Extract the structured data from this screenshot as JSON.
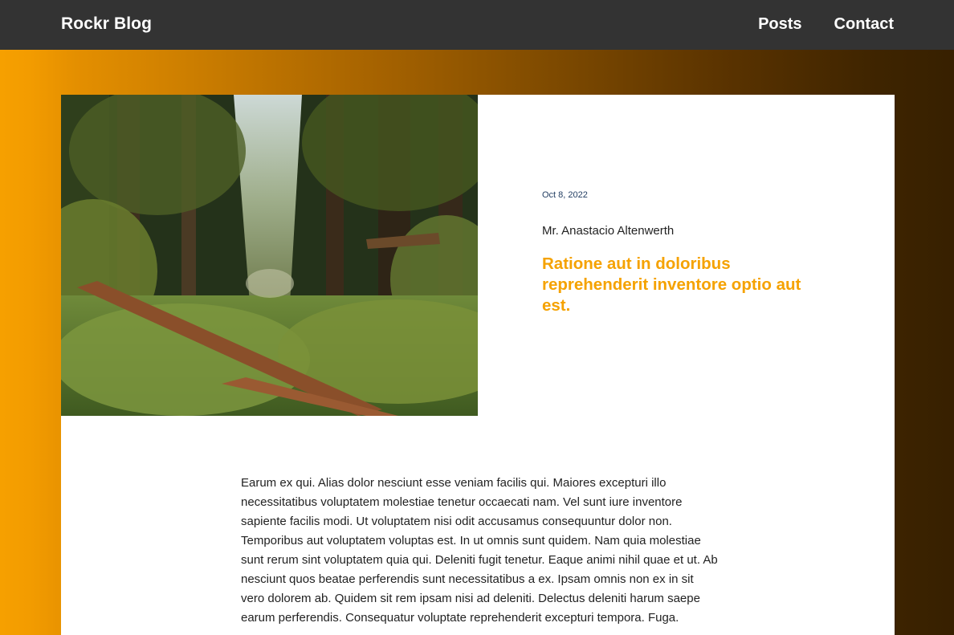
{
  "header": {
    "brand": "Rockr Blog",
    "nav": {
      "posts": "Posts",
      "contact": "Contact"
    }
  },
  "post": {
    "image_icon": "forest-photo",
    "date": "Oct 8, 2022",
    "author": "Mr. Anastacio Altenwerth",
    "title": "Ratione aut in doloribus reprehenderit inventore optio aut est.",
    "body": "Earum ex qui. Alias dolor nesciunt esse veniam facilis qui. Maiores excepturi illo necessitatibus voluptatem molestiae tenetur occaecati nam. Vel sunt iure inventore sapiente facilis modi. Ut voluptatem nisi odit accusamus consequuntur dolor non. Temporibus aut voluptatem voluptas est. In ut omnis sunt quidem. Nam quia molestiae sunt rerum sint voluptatem quia qui. Deleniti fugit tenetur. Eaque animi nihil quae et ut. Ab nesciunt quos beatae perferendis sunt necessitatibus a ex. Ipsam omnis non ex in sit vero dolorem ab. Quidem sit rem ipsam nisi ad deleniti. Delectus deleniti harum saepe earum perferendis. Consequatur voluptate reprehenderit excepturi tempora. Fuga."
  },
  "colors": {
    "header_bg": "#333333",
    "accent": "#f5a200",
    "gradient_start": "#f6a000",
    "gradient_end": "#372000"
  }
}
